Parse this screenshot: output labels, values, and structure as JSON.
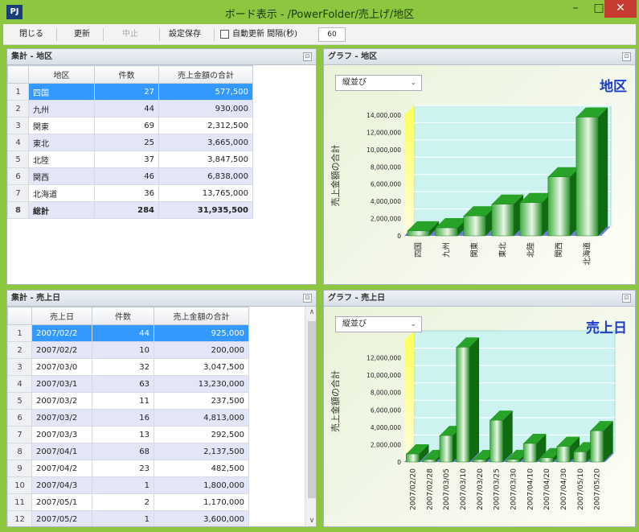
{
  "window": {
    "title": "ボード表示 - /PowerFolder/売上げ/地区",
    "app_icon": "PJ",
    "minimize": "–",
    "maximize": "□",
    "close": "✕"
  },
  "toolbar": {
    "close_label": "閉じる",
    "refresh_label": "更新",
    "stop_label": "中止",
    "save_settings_label": "設定保存",
    "auto_refresh_label": "自動更新 間隔(秒)",
    "auto_refresh_checked": false,
    "interval_value": "60"
  },
  "region_table": {
    "title": "集計 - 地区",
    "close_icon": "⊡",
    "columns": [
      "地区",
      "件数",
      "売上金額の合計"
    ],
    "rows": [
      {
        "n": "1",
        "name": "四国",
        "count": "27",
        "amount": "577,500"
      },
      {
        "n": "2",
        "name": "九州",
        "count": "44",
        "amount": "930,000"
      },
      {
        "n": "3",
        "name": "関東",
        "count": "69",
        "amount": "2,312,500"
      },
      {
        "n": "4",
        "name": "東北",
        "count": "25",
        "amount": "3,665,000"
      },
      {
        "n": "5",
        "name": "北陸",
        "count": "37",
        "amount": "3,847,500"
      },
      {
        "n": "6",
        "name": "関西",
        "count": "46",
        "amount": "6,838,000"
      },
      {
        "n": "7",
        "name": "北海道",
        "count": "36",
        "amount": "13,765,000"
      },
      {
        "n": "8",
        "name": "総計",
        "count": "284",
        "amount": "31,935,500"
      }
    ]
  },
  "region_chart": {
    "title": "グラフ - 地区",
    "close_icon": "⊡",
    "dropdown_value": "縦並び",
    "dropdown_arrow": "⌄",
    "chart_title": "地区",
    "chart_data": {
      "type": "bar",
      "title": "地区",
      "ylabel": "売上金額の合計",
      "xlabel": "",
      "categories": [
        "四国",
        "九州",
        "関東",
        "東北",
        "北陸",
        "関西",
        "北海道"
      ],
      "values": [
        577500,
        930000,
        2312500,
        3665000,
        3847500,
        6838000,
        13765000
      ],
      "ylim": [
        0,
        14000000
      ],
      "yticks": [
        "14,000,000",
        "12,000,000",
        "10,000,000",
        "8,000,000",
        "6,000,000",
        "4,000,000",
        "2,000,000",
        "0"
      ],
      "bar_color": "#1e8a1e",
      "grid": true
    }
  },
  "date_table": {
    "title": "集計 - 売上日",
    "close_icon": "⊡",
    "columns": [
      "売上日",
      "件数",
      "売上金額の合計"
    ],
    "scroll_up": "∧",
    "scroll_down": "∨",
    "rows": [
      {
        "n": "1",
        "name": "2007/02/2",
        "count": "44",
        "amount": "925,000"
      },
      {
        "n": "2",
        "name": "2007/02/2",
        "count": "10",
        "amount": "200,000"
      },
      {
        "n": "3",
        "name": "2007/03/0",
        "count": "32",
        "amount": "3,047,500"
      },
      {
        "n": "4",
        "name": "2007/03/1",
        "count": "63",
        "amount": "13,230,000"
      },
      {
        "n": "5",
        "name": "2007/03/2",
        "count": "11",
        "amount": "237,500"
      },
      {
        "n": "6",
        "name": "2007/03/2",
        "count": "16",
        "amount": "4,813,000"
      },
      {
        "n": "7",
        "name": "2007/03/3",
        "count": "13",
        "amount": "292,500"
      },
      {
        "n": "8",
        "name": "2007/04/1",
        "count": "68",
        "amount": "2,137,500"
      },
      {
        "n": "9",
        "name": "2007/04/2",
        "count": "23",
        "amount": "482,500"
      },
      {
        "n": "10",
        "name": "2007/04/3",
        "count": "1",
        "amount": "1,800,000"
      },
      {
        "n": "11",
        "name": "2007/05/1",
        "count": "2",
        "amount": "1,170,000"
      },
      {
        "n": "12",
        "name": "2007/05/2",
        "count": "1",
        "amount": "3,600,000"
      }
    ]
  },
  "date_chart": {
    "title": "グラフ - 売上日",
    "close_icon": "⊡",
    "dropdown_value": "縦並び",
    "dropdown_arrow": "⌄",
    "chart_title": "売上日",
    "chart_data": {
      "type": "bar",
      "title": "売上日",
      "ylabel": "売上金額の合計",
      "xlabel": "",
      "categories": [
        "2007/02/20",
        "2007/02/28",
        "2007/03/05",
        "2007/03/10",
        "2007/03/20",
        "2007/03/25",
        "2007/03/30",
        "2007/04/10",
        "2007/04/20",
        "2007/04/30",
        "2007/05/10",
        "2007/05/20"
      ],
      "values": [
        925000,
        200000,
        3047500,
        13230000,
        237500,
        4813000,
        292500,
        2137500,
        482500,
        1800000,
        1170000,
        3600000
      ],
      "ylim": [
        0,
        14000000
      ],
      "yticks": [
        "12,000,000",
        "10,000,000",
        "8,000,000",
        "6,000,000",
        "4,000,000",
        "2,000,000",
        "0"
      ],
      "bar_color": "#1e8a1e",
      "grid": true
    }
  }
}
